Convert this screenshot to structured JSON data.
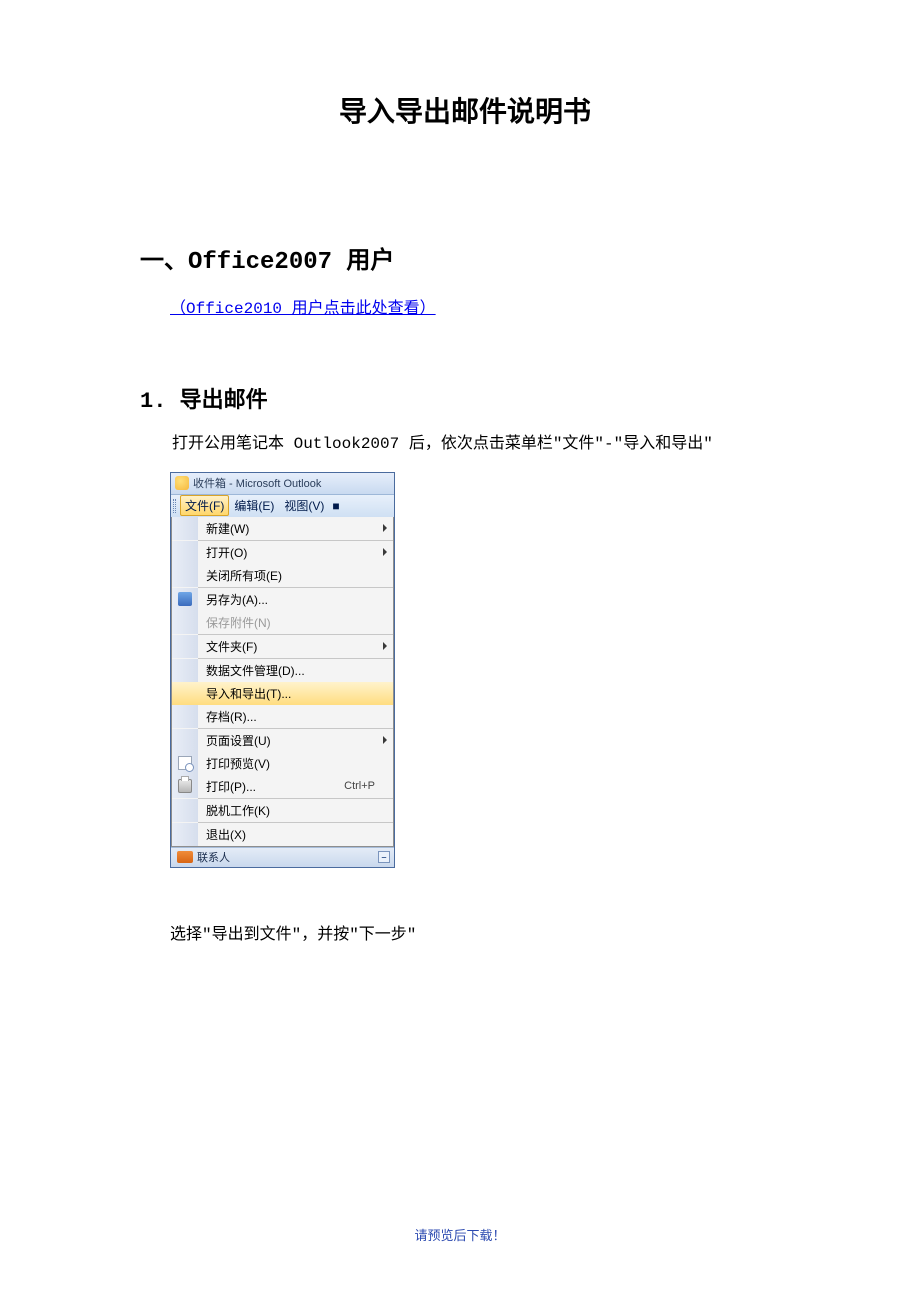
{
  "doc": {
    "title": "导入导出邮件说明书",
    "section1_heading": "一、Office2007 用户",
    "link_2010": "（Office2010 用户点击此处查看）",
    "subsection1_heading": "1. 导出邮件",
    "para1": "打开公用笔记本 Outlook2007 后，依次点击菜单栏\"文件\"-\"导入和导出\"",
    "para2": "选择\"导出到文件\"，并按\"下一步\"",
    "footer": "请预览后下载！"
  },
  "outlook": {
    "title": "收件箱 - Microsoft Outlook",
    "menubar": {
      "file": "文件(F)",
      "edit": "编辑(E)",
      "view": "视图(V)",
      "bullet": "■"
    },
    "menu": {
      "new": "新建(W)",
      "open": "打开(O)",
      "close_all": "关闭所有项(E)",
      "save_as": "另存为(A)...",
      "save_attach": "保存附件(N)",
      "folder": "文件夹(F)",
      "data_mgmt": "数据文件管理(D)...",
      "import_export": "导入和导出(T)...",
      "archive": "存档(R)...",
      "page_setup": "页面设置(U)",
      "print_preview": "打印预览(V)",
      "print": "打印(P)...",
      "print_shortcut": "Ctrl+P",
      "offline": "脱机工作(K)",
      "exit": "退出(X)"
    },
    "bottom": {
      "label": "联系人",
      "toggle": "–"
    }
  }
}
